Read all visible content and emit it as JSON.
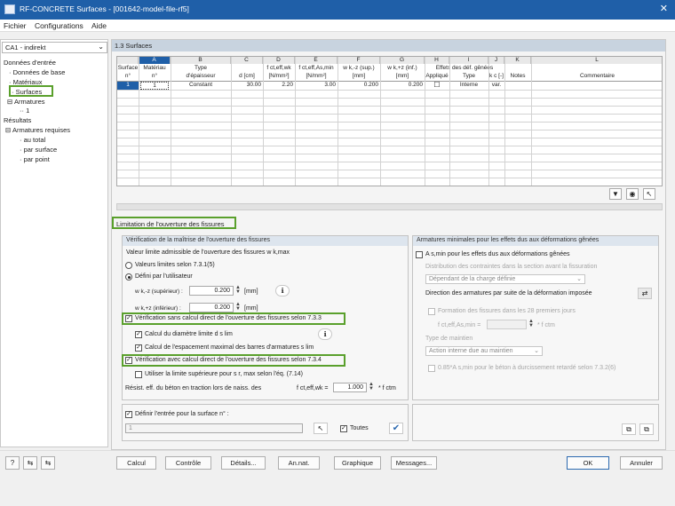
{
  "window": {
    "title": "RF-CONCRETE Surfaces - [001642-model-file-rf5]"
  },
  "menu": [
    "Fichier",
    "Configurations",
    "Aide"
  ],
  "left": {
    "combo_value": "CA1 - indirekt",
    "tree": [
      {
        "label": "Données d'entrée",
        "indent": 0
      },
      {
        "label": "Données de base",
        "indent": 1
      },
      {
        "label": "Matériaux",
        "indent": 1
      },
      {
        "label": "Surfaces",
        "indent": 1
      },
      {
        "label": "Armatures",
        "indent": 1
      },
      {
        "label": "1",
        "indent": 2
      },
      {
        "label": "Résultats",
        "indent": 0
      },
      {
        "label": "Armatures requises",
        "indent": 1
      },
      {
        "label": "au total",
        "indent": 2
      },
      {
        "label": "par surface",
        "indent": 2
      },
      {
        "label": "par point",
        "indent": 2
      }
    ]
  },
  "section_title": "1.3 Surfaces",
  "table": {
    "letters": [
      "A",
      "B",
      "C",
      "D",
      "E",
      "F",
      "G",
      "H",
      "I",
      "J",
      "K",
      "L"
    ],
    "header1": [
      "Surface",
      "Matériau",
      "Type",
      "",
      "f ct,eff,wk",
      "f ct,eff,As,min",
      "w k,-z (sup.)",
      "w k,+z (inf.)",
      "Effets des déf. gênées",
      "",
      "",
      ""
    ],
    "header2": [
      "n°",
      "n°",
      "d'épaisseur",
      "d [cm]",
      "[N/mm²]",
      "[N/mm²]",
      "[mm]",
      "[mm]",
      "Appliqué",
      "Type",
      "k c [-]",
      "Notes",
      "Commentaire"
    ],
    "row": [
      "1",
      "1",
      "Constant",
      "30.00",
      "2.20",
      "3.00",
      "0.200",
      "0.200",
      "☐",
      "Interne",
      "var.",
      "",
      ""
    ]
  },
  "tab_label": "Limitation de l'ouverture des fissures",
  "verif": {
    "header": "Vérification de la maîtrise de l'ouverture des fissures",
    "allowable": "Valeur limite admissible de l'ouverture des fissures w k,max",
    "radio1": "Valeurs limites selon 7.3.1(5)",
    "radio2": "Défini par l'utilisateur",
    "wk_sup_label": "w k,-z (supérieur) :",
    "wk_sup_value": "0.200",
    "wk_inf_label": "w k,+z (inférieur) :",
    "wk_inf_value": "0.200",
    "unit_mm": "[mm]",
    "chk_733": "Vérification sans calcul direct de l'ouverture des fissures selon 7.3.3",
    "chk_diam": "Calcul du diamètre limite d s lim",
    "chk_esp": "Calcul de l'espacement maximal des barres d'armatures s lim",
    "chk_734": "Vérification avec calcul direct de l'ouverture des fissures selon 7.3.4",
    "chk_sup": "Utiliser la limite supérieure pour s r, max selon l'éq. (7.14)",
    "resist_label": "Résist. eff. du béton en traction lors de naiss. des",
    "resist_sym": "f ct,eff,wk =",
    "resist_value": "1.000",
    "resist_unit": "* f ctm"
  },
  "arm": {
    "header": "Armatures minimales pour les effets dus aux déformations gênées",
    "chk_as": "A s,min pour les effets dus aux déformations gênées",
    "distrib_label": "Distribution des contraintes dans la section avant la fissuration",
    "distrib_value": "Dépendant de la charge définie",
    "direction_label": "Direction des armatures par suite de la déformation imposée",
    "chk_28": "Formation des fissures dans les 28 premiers jours",
    "fct_label": "f ct,eff,As,min =",
    "fct_unit": "* f ctm",
    "maintien_label": "Type de maintien",
    "maintien_value": "Action interne due au maintien",
    "chk_085": "0.85*A s,min pour le béton à durcissement retardé selon 7.3.2(6)"
  },
  "define": {
    "chk": "Définir l'entrée pour la surface n° :",
    "value": "1",
    "toutes": "Toutes"
  },
  "buttons": [
    "Calcul",
    "Contrôle",
    "Détails...",
    "An.nat.",
    "Graphique",
    "Messages...",
    "OK",
    "Annuler"
  ]
}
